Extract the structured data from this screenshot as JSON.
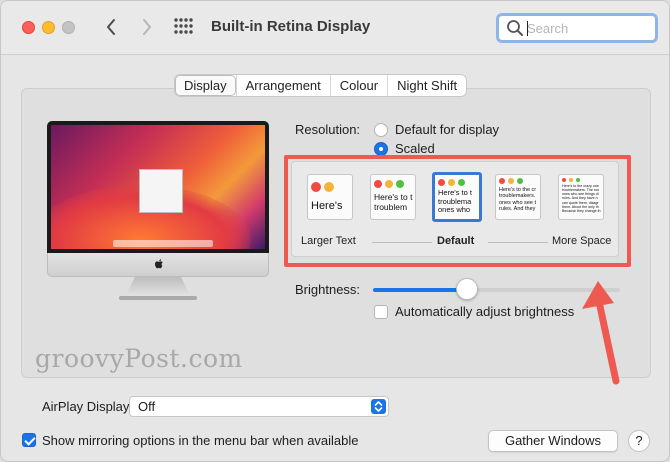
{
  "window": {
    "title": "Built-in Retina Display"
  },
  "search": {
    "placeholder": "Search"
  },
  "tabs": [
    {
      "label": "Display",
      "active": true
    },
    {
      "label": "Arrangement",
      "active": false
    },
    {
      "label": "Colour",
      "active": false
    },
    {
      "label": "Night Shift",
      "active": false
    }
  ],
  "resolution": {
    "label": "Resolution:",
    "options": [
      {
        "label": "Default for display",
        "selected": false
      },
      {
        "label": "Scaled",
        "selected": true
      }
    ]
  },
  "scaling": {
    "thumbnails": [
      {
        "text": "Here's",
        "selected": false
      },
      {
        "text": "Here's to t\ntroublem",
        "selected": false
      },
      {
        "text": "Here's to t\ntroublema\nones who",
        "selected": true
      },
      {
        "text": "Here's to the cr\ntroublemakers.\nones who see t\nrules. And they",
        "selected": false
      },
      {
        "text": "Here's to the crazy one\ntroublemakers. The rou\nones who see things di\nrules. And they have n\ncan quote them, disagr\nthem. About the only th\nBecause they change th",
        "selected": false
      }
    ],
    "labels": {
      "left": "Larger Text",
      "center": "Default",
      "right": "More Space"
    }
  },
  "brightness": {
    "label": "Brightness:",
    "level": 0.38,
    "auto_label": "Automatically adjust brightness",
    "auto_checked": false
  },
  "watermark": "groovyPost.com",
  "airplay": {
    "label": "AirPlay Display:",
    "value": "Off"
  },
  "mirroring": {
    "label": "Show mirroring options in the menu bar when available",
    "checked": true
  },
  "buttons": {
    "gather": "Gather Windows",
    "help": "?"
  },
  "colors": {
    "accent": "#1a73e8",
    "highlight": "#ef5a50",
    "close": "#fe5f57",
    "minimize": "#febc2e",
    "zoom_disabled": "#c4c4c4"
  },
  "icons": [
    "chevron-left-icon",
    "chevron-right-icon",
    "grid-icon",
    "search-icon",
    "apple-logo-icon",
    "up-down-stepper-icon",
    "arrow-annotation-icon"
  ]
}
